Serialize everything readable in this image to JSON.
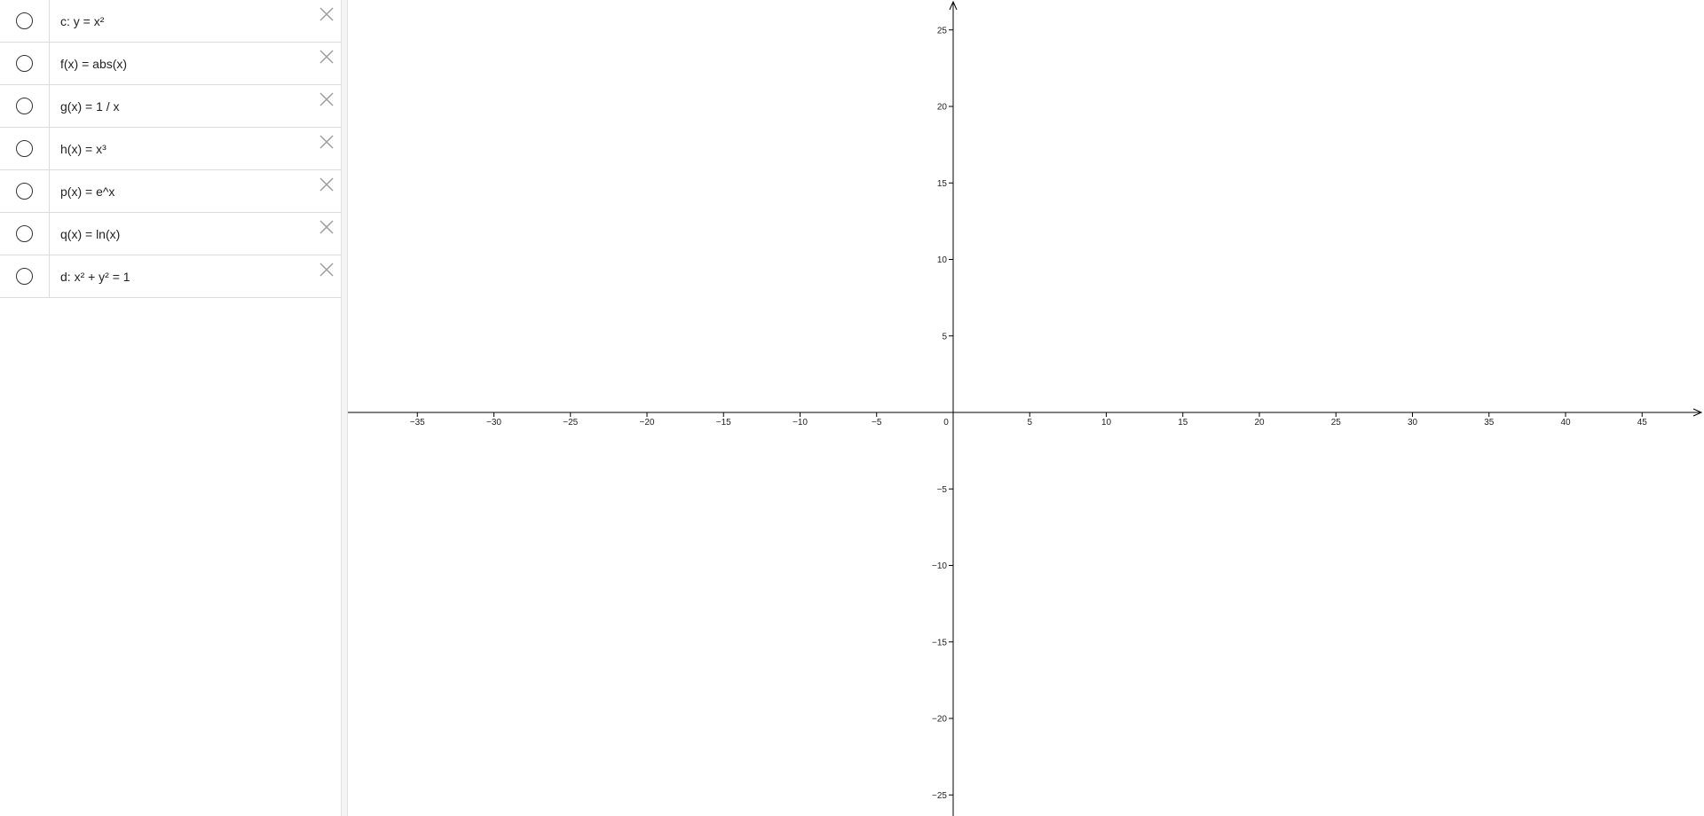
{
  "algebra_view": {
    "items": [
      {
        "name": "c",
        "expression": "c: y = x²"
      },
      {
        "name": "f",
        "expression": "f(x) = abs(x)"
      },
      {
        "name": "g",
        "expression": "g(x) = 1 / x"
      },
      {
        "name": "h",
        "expression": "h(x) = x³"
      },
      {
        "name": "p",
        "expression": "p(x) = e^x"
      },
      {
        "name": "q",
        "expression": "q(x) = ln(x)"
      },
      {
        "name": "d",
        "expression": "d: x² + y² = 1"
      }
    ]
  },
  "graphics_view": {
    "x_axis": {
      "ticks": [
        -35,
        -30,
        -25,
        -20,
        -15,
        -10,
        -5,
        0,
        5,
        10,
        15,
        20,
        25,
        30,
        35,
        40,
        45
      ],
      "labels": [
        "−35",
        "−30",
        "−25",
        "−20",
        "−15",
        "−10",
        "−5",
        "0",
        "5",
        "10",
        "15",
        "20",
        "25",
        "30",
        "35",
        "40",
        "45"
      ]
    },
    "y_axis": {
      "ticks": [
        25,
        20,
        15,
        10,
        5,
        -5,
        -10,
        -15,
        -20,
        -25
      ],
      "labels": [
        "25",
        "20",
        "15",
        "10",
        "5",
        "−5",
        "−10",
        "−15",
        "−20",
        "−25"
      ]
    },
    "axis_color": "#000000"
  }
}
